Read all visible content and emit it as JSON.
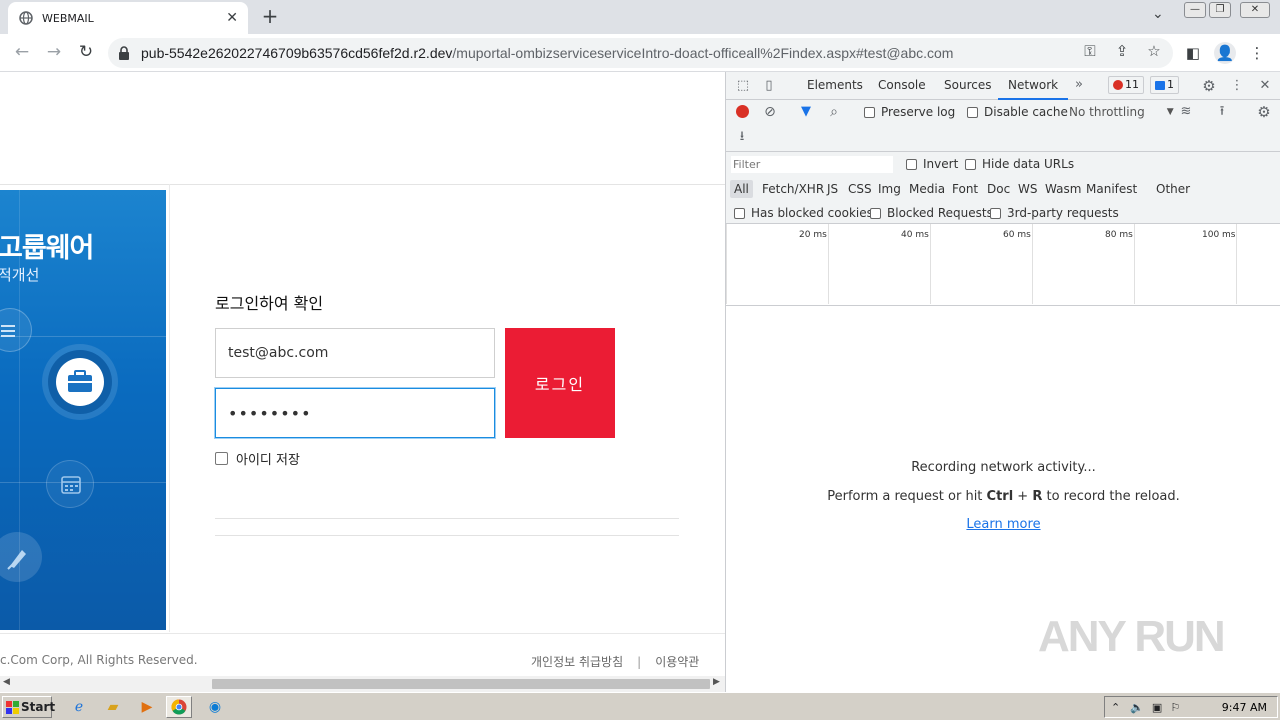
{
  "browser": {
    "tab_title": "WEBMAIL",
    "url_host": "pub-5542e262022746709b63576cd56fef2d.r2.dev",
    "url_path": "/muportal-ombizserviceserviceIntro-doact-officeall%2Findex.aspx#test@abc.com"
  },
  "page": {
    "banner_title": "고룹웨어",
    "banner_subtitle": "적개선",
    "login_title": "로그인하여 확인",
    "email_value": "test@abc.com",
    "password_mask": "••••••••",
    "login_button": "로그인",
    "remember_label": "아이디 저장",
    "copyright": "c.Com Corp, All Rights Reserved.",
    "footer_privacy": "개인정보 취급방침",
    "footer_separator": "|",
    "footer_terms": "이용약관"
  },
  "devtools": {
    "tabs": [
      "Elements",
      "Console",
      "Sources",
      "Network"
    ],
    "error_count": "11",
    "message_count": "1",
    "preserve_log": "Preserve log",
    "disable_cache": "Disable cache",
    "throttling": "No throttling",
    "filter_placeholder": "Filter",
    "invert": "Invert",
    "hide_data_urls": "Hide data URLs",
    "types": [
      "All",
      "Fetch/XHR",
      "JS",
      "CSS",
      "Img",
      "Media",
      "Font",
      "Doc",
      "WS",
      "Wasm",
      "Manifest",
      "Other"
    ],
    "has_blocked_cookies": "Has blocked cookies",
    "blocked_requests": "Blocked Requests",
    "third_party": "3rd-party requests",
    "timeline_ticks": [
      "20 ms",
      "40 ms",
      "60 ms",
      "80 ms",
      "100 ms"
    ],
    "recording": "Recording network activity...",
    "hint_pre": "Perform a request or hit ",
    "hint_ctrl": "Ctrl",
    "hint_plus": " + ",
    "hint_r": "R",
    "hint_post": " to record the reload.",
    "learn_more": "Learn more"
  },
  "watermark": "ANY RUN",
  "taskbar": {
    "start": "Start",
    "clock": "9:47 AM"
  },
  "colors": {
    "login_red": "#eb1c34",
    "banner_blue": "#0a6bbf",
    "devtools_accent": "#1a73e8"
  }
}
